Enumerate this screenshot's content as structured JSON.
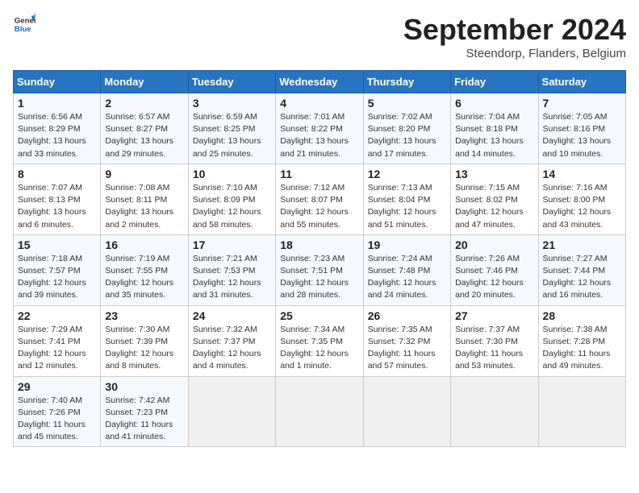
{
  "header": {
    "logo_line1": "General",
    "logo_line2": "Blue",
    "month": "September 2024",
    "location": "Steendorp, Flanders, Belgium"
  },
  "weekdays": [
    "Sunday",
    "Monday",
    "Tuesday",
    "Wednesday",
    "Thursday",
    "Friday",
    "Saturday"
  ],
  "weeks": [
    [
      {
        "day": "1",
        "info": "Sunrise: 6:56 AM\nSunset: 8:29 PM\nDaylight: 13 hours\nand 33 minutes."
      },
      {
        "day": "2",
        "info": "Sunrise: 6:57 AM\nSunset: 8:27 PM\nDaylight: 13 hours\nand 29 minutes."
      },
      {
        "day": "3",
        "info": "Sunrise: 6:59 AM\nSunset: 8:25 PM\nDaylight: 13 hours\nand 25 minutes."
      },
      {
        "day": "4",
        "info": "Sunrise: 7:01 AM\nSunset: 8:22 PM\nDaylight: 13 hours\nand 21 minutes."
      },
      {
        "day": "5",
        "info": "Sunrise: 7:02 AM\nSunset: 8:20 PM\nDaylight: 13 hours\nand 17 minutes."
      },
      {
        "day": "6",
        "info": "Sunrise: 7:04 AM\nSunset: 8:18 PM\nDaylight: 13 hours\nand 14 minutes."
      },
      {
        "day": "7",
        "info": "Sunrise: 7:05 AM\nSunset: 8:16 PM\nDaylight: 13 hours\nand 10 minutes."
      }
    ],
    [
      {
        "day": "8",
        "info": "Sunrise: 7:07 AM\nSunset: 8:13 PM\nDaylight: 13 hours\nand 6 minutes."
      },
      {
        "day": "9",
        "info": "Sunrise: 7:08 AM\nSunset: 8:11 PM\nDaylight: 13 hours\nand 2 minutes."
      },
      {
        "day": "10",
        "info": "Sunrise: 7:10 AM\nSunset: 8:09 PM\nDaylight: 12 hours\nand 58 minutes."
      },
      {
        "day": "11",
        "info": "Sunrise: 7:12 AM\nSunset: 8:07 PM\nDaylight: 12 hours\nand 55 minutes."
      },
      {
        "day": "12",
        "info": "Sunrise: 7:13 AM\nSunset: 8:04 PM\nDaylight: 12 hours\nand 51 minutes."
      },
      {
        "day": "13",
        "info": "Sunrise: 7:15 AM\nSunset: 8:02 PM\nDaylight: 12 hours\nand 47 minutes."
      },
      {
        "day": "14",
        "info": "Sunrise: 7:16 AM\nSunset: 8:00 PM\nDaylight: 12 hours\nand 43 minutes."
      }
    ],
    [
      {
        "day": "15",
        "info": "Sunrise: 7:18 AM\nSunset: 7:57 PM\nDaylight: 12 hours\nand 39 minutes."
      },
      {
        "day": "16",
        "info": "Sunrise: 7:19 AM\nSunset: 7:55 PM\nDaylight: 12 hours\nand 35 minutes."
      },
      {
        "day": "17",
        "info": "Sunrise: 7:21 AM\nSunset: 7:53 PM\nDaylight: 12 hours\nand 31 minutes."
      },
      {
        "day": "18",
        "info": "Sunrise: 7:23 AM\nSunset: 7:51 PM\nDaylight: 12 hours\nand 28 minutes."
      },
      {
        "day": "19",
        "info": "Sunrise: 7:24 AM\nSunset: 7:48 PM\nDaylight: 12 hours\nand 24 minutes."
      },
      {
        "day": "20",
        "info": "Sunrise: 7:26 AM\nSunset: 7:46 PM\nDaylight: 12 hours\nand 20 minutes."
      },
      {
        "day": "21",
        "info": "Sunrise: 7:27 AM\nSunset: 7:44 PM\nDaylight: 12 hours\nand 16 minutes."
      }
    ],
    [
      {
        "day": "22",
        "info": "Sunrise: 7:29 AM\nSunset: 7:41 PM\nDaylight: 12 hours\nand 12 minutes."
      },
      {
        "day": "23",
        "info": "Sunrise: 7:30 AM\nSunset: 7:39 PM\nDaylight: 12 hours\nand 8 minutes."
      },
      {
        "day": "24",
        "info": "Sunrise: 7:32 AM\nSunset: 7:37 PM\nDaylight: 12 hours\nand 4 minutes."
      },
      {
        "day": "25",
        "info": "Sunrise: 7:34 AM\nSunset: 7:35 PM\nDaylight: 12 hours\nand 1 minute."
      },
      {
        "day": "26",
        "info": "Sunrise: 7:35 AM\nSunset: 7:32 PM\nDaylight: 11 hours\nand 57 minutes."
      },
      {
        "day": "27",
        "info": "Sunrise: 7:37 AM\nSunset: 7:30 PM\nDaylight: 11 hours\nand 53 minutes."
      },
      {
        "day": "28",
        "info": "Sunrise: 7:38 AM\nSunset: 7:28 PM\nDaylight: 11 hours\nand 49 minutes."
      }
    ],
    [
      {
        "day": "29",
        "info": "Sunrise: 7:40 AM\nSunset: 7:26 PM\nDaylight: 11 hours\nand 45 minutes."
      },
      {
        "day": "30",
        "info": "Sunrise: 7:42 AM\nSunset: 7:23 PM\nDaylight: 11 hours\nand 41 minutes."
      },
      {
        "day": "",
        "info": ""
      },
      {
        "day": "",
        "info": ""
      },
      {
        "day": "",
        "info": ""
      },
      {
        "day": "",
        "info": ""
      },
      {
        "day": "",
        "info": ""
      }
    ]
  ]
}
